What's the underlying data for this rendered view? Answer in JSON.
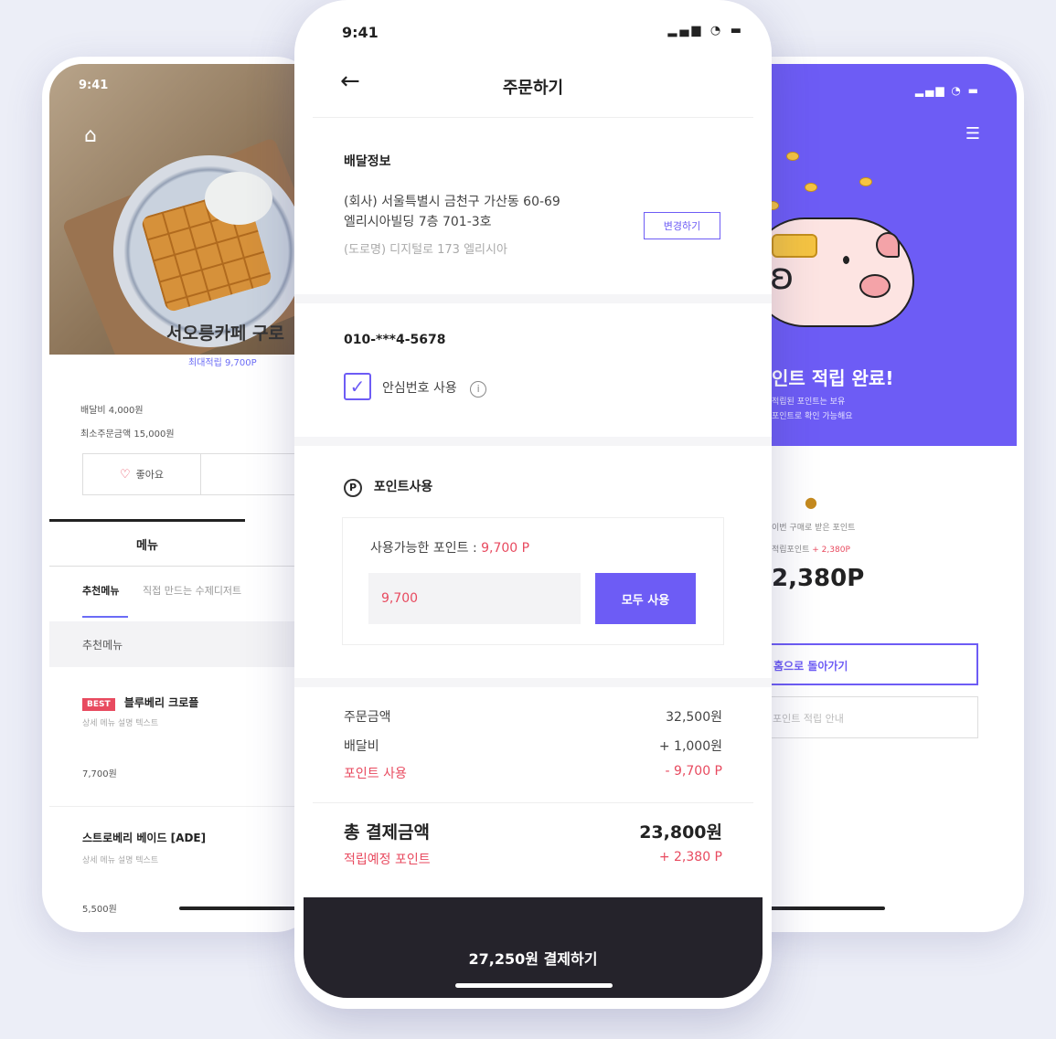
{
  "left": {
    "time": "9:41",
    "store_name": "서오릉카페 구로",
    "store_sub": "최대적립 9,700P",
    "info_delivery": "배달비 4,000원",
    "info_min": "최소주문금액 15,000원",
    "like_button": "좋아요",
    "tab_menu": "메뉴",
    "subtab_recommend": "추천메뉴",
    "subtab_other": "직접 만드는 수제디저트",
    "section_recommend": "추천메뉴",
    "item1_badge": "BEST",
    "item1_name": "블루베리 크로플",
    "item1_desc": "상세 메뉴 설명 텍스트",
    "item1_price": "7,700원",
    "item2_name": "스트로베리 베이드 [ADE]",
    "item2_desc": "상세 메뉴 설명 텍스트",
    "item2_price": "5,500원"
  },
  "right": {
    "complete_title": "인트 적립 완료!",
    "complete_sub1": "적립된 포인트는 보유",
    "complete_sub2": "포인트로 확인 가능해요",
    "earned_label": "이번 구매로 받은 포인트",
    "earned_value": "적립포인트",
    "earned_plus": "+ 2,380P",
    "points": "2,380P",
    "home_button": "홈으로 돌아가기",
    "guide_button": "포인트 적립 안내"
  },
  "center": {
    "time": "9:41",
    "status_icons": "▂▄▆ ◔ ▬",
    "title": "주문하기",
    "delivery_heading": "배달정보",
    "address1": "(회사) 서울특별시 금천구 가산동 60-69",
    "address2": "엘리시아빌딩 7층 701-3호",
    "address_road": "(도로명) 디지털로 173 엘리시아",
    "edit_button": "변경하기",
    "phone": "010-***4-5678",
    "safe_number": "안심번호 사용",
    "points_heading": "포인트사용",
    "available_label": "사용가능한 포인트 :",
    "available_value": "9,700 P",
    "point_input": "9,700",
    "use_all_button": "모두 사용",
    "order_amount_label": "주문금액",
    "order_amount": "32,500원",
    "delivery_fee_label": "배달비",
    "delivery_fee": "+ 1,000원",
    "point_use_label": "포인트 사용",
    "point_use": "- 9,700 P",
    "total_label": "총 결제금액",
    "total": "23,800원",
    "earn_label": "적립예정 포인트",
    "earn": "+ 2,380 P",
    "pay_button": "27,250원 결제하기"
  },
  "colors": {
    "accent": "#6d5cf5",
    "red": "#e84a5f",
    "dark": "#25232b"
  }
}
